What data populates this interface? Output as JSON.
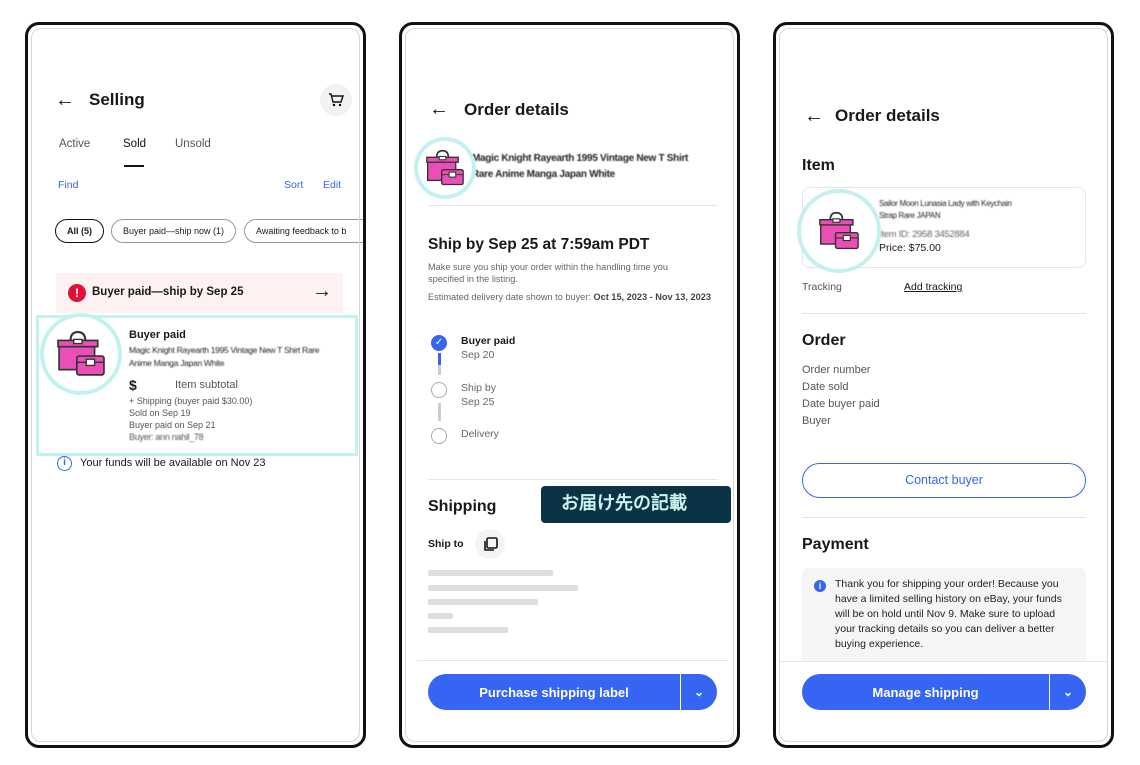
{
  "selling": {
    "title": "Selling",
    "tabs": [
      {
        "label": "Active"
      },
      {
        "label": "Sold",
        "selected": true
      },
      {
        "label": "Unsold"
      }
    ],
    "find": "Find",
    "sort": "Sort",
    "edit": "Edit",
    "chips": [
      "All (5)",
      "Buyer paid—ship now (1)",
      "Awaiting feedback to b"
    ],
    "banner": "Buyer paid—ship by Sep 25",
    "card": {
      "status": "Buyer paid",
      "item_title": "Magic Knight Rayearth 1995 Vintage New T Shirt Rare Anime Manga Japan White",
      "price_symbol": "$",
      "subtotal_label": "Item subtotal",
      "shipping": "+ Shipping (buyer paid $30.00)",
      "sold_on": "Sold on Sep 19",
      "paid_on": "Buyer paid on Sep 21",
      "buyer": "Buyer: ann nahil_78"
    },
    "funds_note": "Your funds will be available on Nov 23"
  },
  "order1": {
    "title": "Order details",
    "item_title": "Magic Knight Rayearth 1995 Vintage New T Shirt Rare Anime Manga Japan White",
    "ship_by": "Ship by Sep 25 at 7:59am PDT",
    "handling_note": "Make sure you ship your order within the handling time you specified in the listing.",
    "est_label": "Estimated delivery date shown to buyer: ",
    "est_value": "Oct 15, 2023 - Nov 13, 2023",
    "timeline": [
      {
        "label": "Buyer paid",
        "date": "Sep 20",
        "done": true
      },
      {
        "label": "Ship by",
        "date": "Sep 25",
        "done": false
      },
      {
        "label": "Delivery",
        "date": "",
        "done": false
      }
    ],
    "shipping_heading": "Shipping",
    "annotation": "お届け先の記載",
    "ship_to": "Ship to",
    "purchase_label": "Purchase shipping label"
  },
  "order2": {
    "title": "Order details",
    "item_heading": "Item",
    "item_title": "Sailor Moon Lunasia Lady with Keychain Strap Rare JAPAN",
    "item_id": "Item ID: 2958 3452884",
    "price": "Price: $75.00",
    "tracking_label": "Tracking",
    "add_tracking": "Add tracking",
    "order_heading": "Order",
    "order_rows": [
      "Order number",
      "Date sold",
      "Date buyer paid",
      "Buyer"
    ],
    "contact_buyer": "Contact buyer",
    "payment_heading": "Payment",
    "payment_note": "Thank you for shipping your order! Because you have a limited selling history on eBay, your funds will be on hold until Nov 9. Make sure to upload your tracking details so you can deliver a better buying experience.",
    "manage_shipping": "Manage shipping"
  },
  "colors": {
    "accent": "#3665f3",
    "highlight": "#c3f2ee",
    "alert": "#e0103a",
    "banner_bg": "#fdf1f1",
    "annotation_bg": "#0b3346",
    "annotation_text": "#c8f4ee"
  }
}
